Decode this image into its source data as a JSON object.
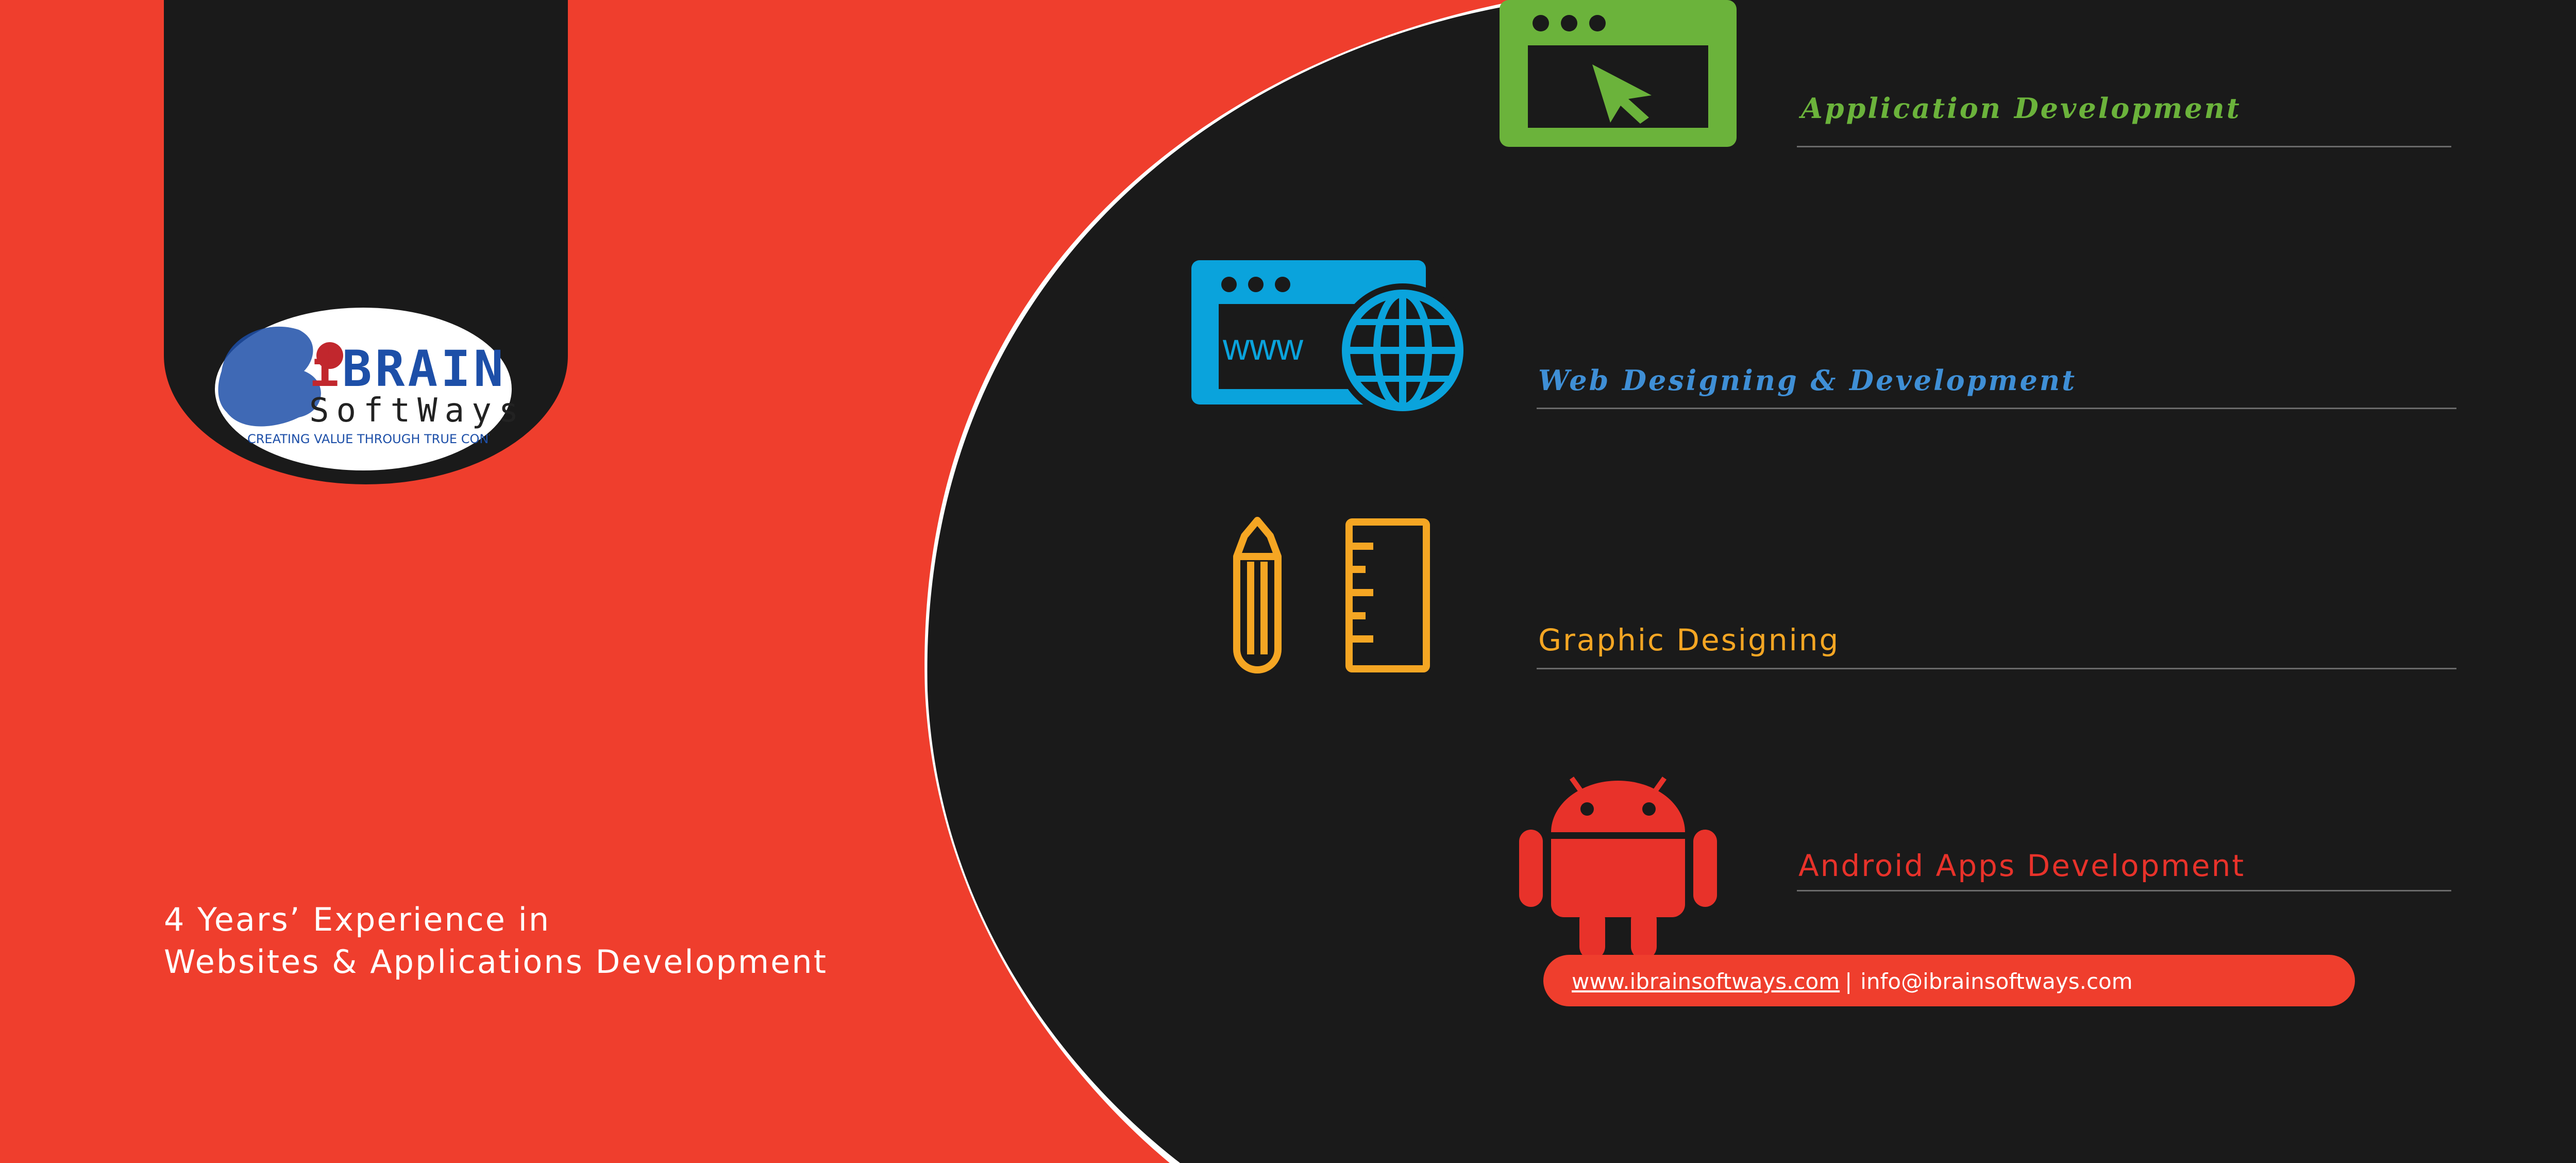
{
  "logo": {
    "brand_i": "i",
    "brand_rest": "BRAIN",
    "sub": "SoftWays",
    "tagline": "CREATING VALUE THROUGH TRUE CONVERSION"
  },
  "experience": {
    "line1": "4   Years’ Experience in",
    "line2": "Websites & Applications Development"
  },
  "services": {
    "app": "Application  Development",
    "web": "Web  Designing  &  Development",
    "graphic": "Graphic  Designing",
    "android": "Android  Apps  Development"
  },
  "icons": {
    "app": "app-window-cursor-icon",
    "web": "browser-globe-www-icon",
    "graphic": "pencil-ruler-icon",
    "android": "android-robot-icon"
  },
  "www_label": "www",
  "contact": {
    "website": "www.ibrainsoftways.com",
    "separator": "|",
    "email": "info@ibrainsoftways.com"
  },
  "colors": {
    "red": "#ef3e2d",
    "dark": "#1a1a1a",
    "green": "#6bb33b",
    "blue": "#3f8fd6",
    "icon_blue": "#0aa3dc",
    "orange": "#f5a623",
    "android_red": "#e8322a"
  }
}
